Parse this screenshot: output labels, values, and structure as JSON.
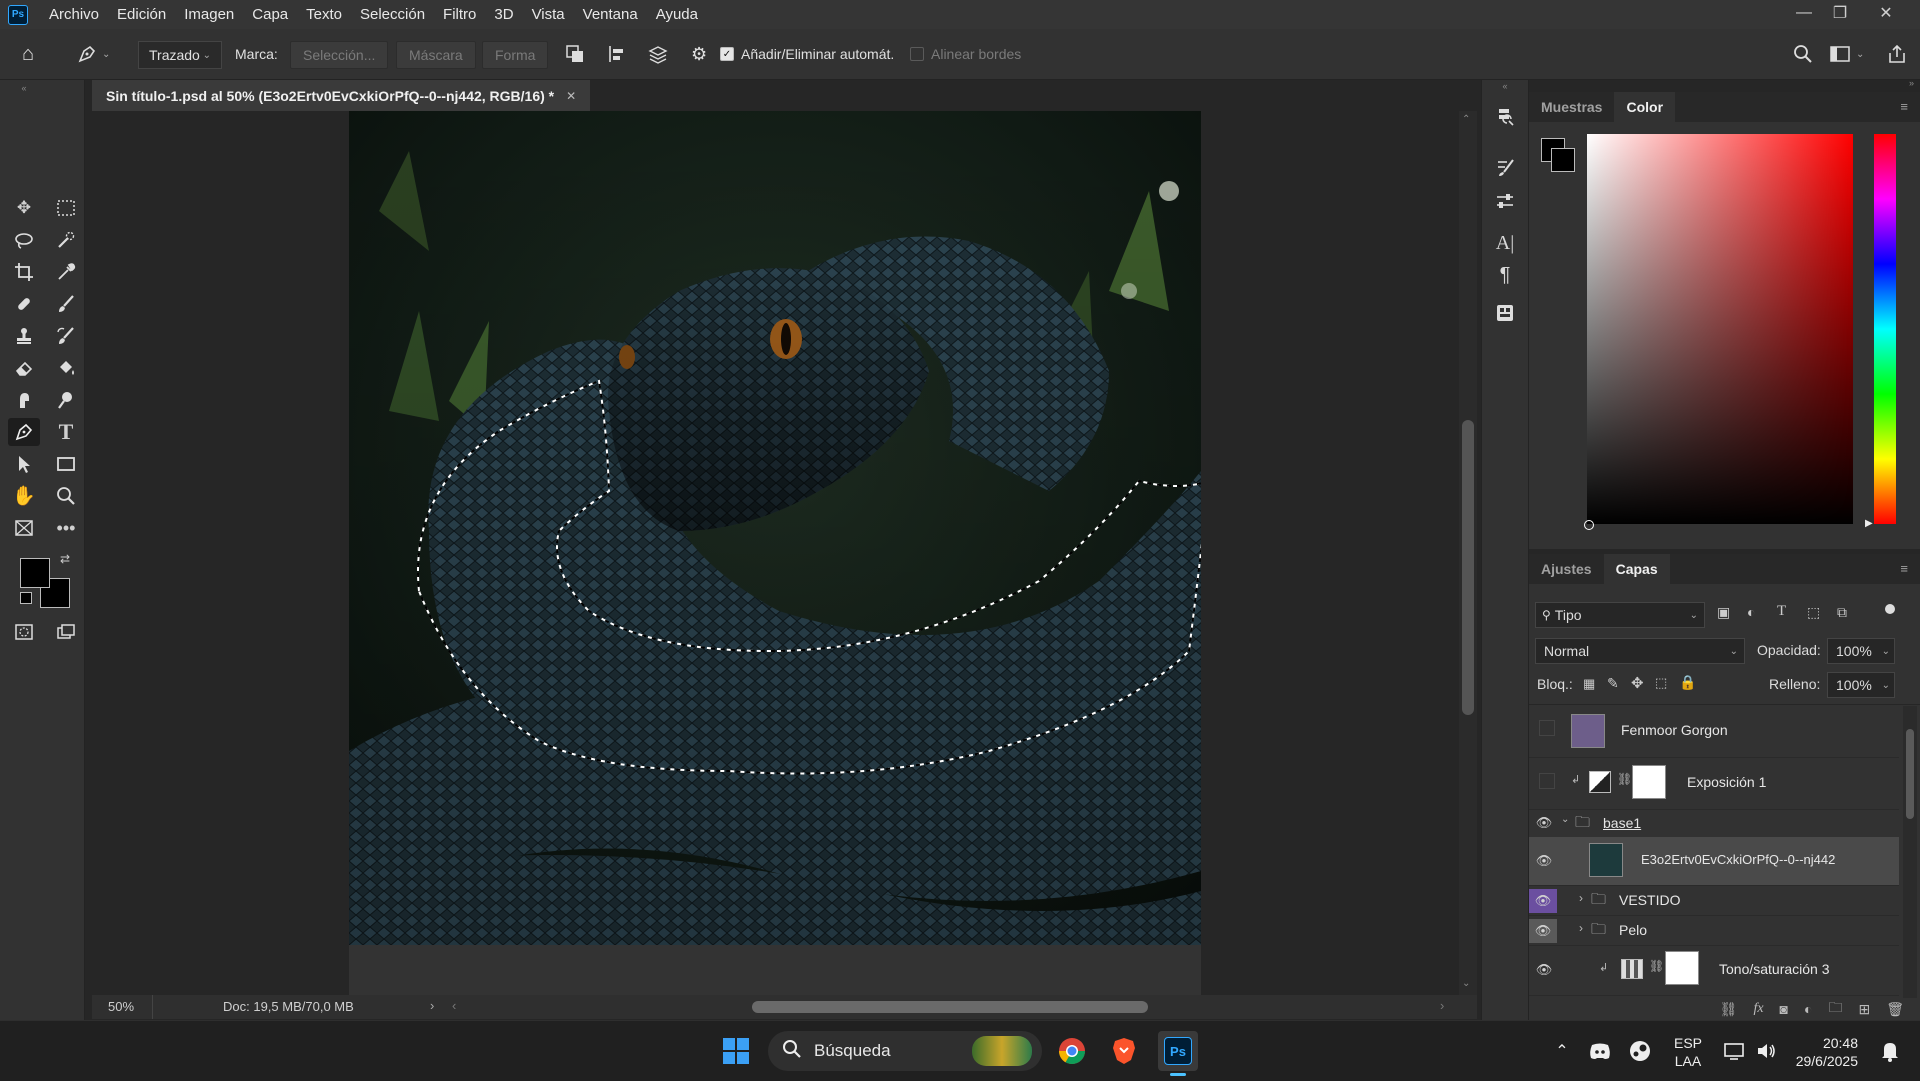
{
  "app": {
    "logo": "Ps"
  },
  "menu": [
    "Archivo",
    "Edición",
    "Imagen",
    "Capa",
    "Texto",
    "Selección",
    "Filtro",
    "3D",
    "Vista",
    "Ventana",
    "Ayuda"
  ],
  "options": {
    "mode_value": "Trazado",
    "marca_label": "Marca:",
    "seleccion_btn": "Selección...",
    "mascara_btn": "Máscara",
    "forma_btn": "Forma",
    "auto_add_label": "Añadir/Eliminar automát.",
    "auto_add_checked": true,
    "align_edges_label": "Alinear bordes",
    "align_edges_checked": false
  },
  "document": {
    "tab_title": "Sin título-1.psd al 50% (E3o2Ertv0EvCxkiOrPfQ--0--nj442, RGB/16) *",
    "zoom": "50%",
    "doc_info": "Doc: 19,5 MB/70,0 MB"
  },
  "colors": {
    "foreground": "#000000",
    "background": "#000000",
    "accent_purple": "#6b4fa0"
  },
  "color_panel": {
    "tabs": [
      "Muestras",
      "Color"
    ],
    "active_tab": "Color"
  },
  "layers_panel": {
    "tabs": [
      "Ajustes",
      "Capas"
    ],
    "active_tab": "Capas",
    "filter_label": "Tipo",
    "blend_mode": "Normal",
    "opacity_label": "Opacidad:",
    "opacity_value": "100%",
    "lock_label": "Bloq.:",
    "fill_label": "Relleno:",
    "fill_value": "100%",
    "layers": [
      {
        "name": "Fenmoor Gorgon",
        "visible": false
      },
      {
        "name": "Exposición 1",
        "visible": false
      },
      {
        "name": "base1",
        "visible": true
      },
      {
        "name": "E3o2Ertv0EvCxkiOrPfQ--0--nj442",
        "visible": true,
        "selected": true
      },
      {
        "name": "VESTIDO",
        "visible": true
      },
      {
        "name": "Pelo",
        "visible": true
      },
      {
        "name": "Tono/saturación 3",
        "visible": true
      }
    ]
  },
  "taskbar": {
    "search_label": "Búsqueda",
    "lang_line1": "ESP",
    "lang_line2": "LAA",
    "time": "20:48",
    "date": "29/6/2025"
  }
}
